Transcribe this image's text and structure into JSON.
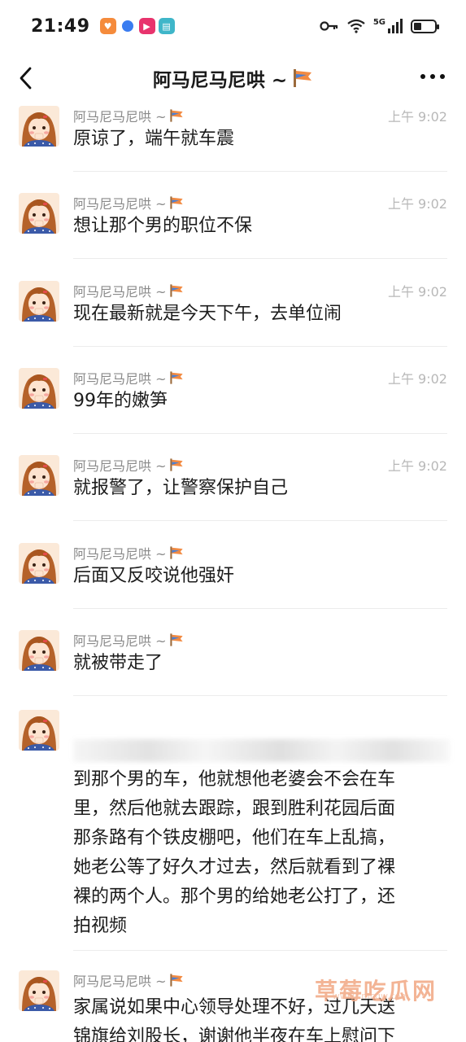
{
  "status_bar": {
    "time": "21:49",
    "network_label": "5G"
  },
  "nav": {
    "title": "阿马尼马尼哄 ~"
  },
  "messages": [
    {
      "sender": "阿马尼马尼哄 ~",
      "time": "上午 9:02",
      "text": "原谅了，端午就车震"
    },
    {
      "sender": "阿马尼马尼哄 ~",
      "time": "上午 9:02",
      "text": "想让那个男的职位不保"
    },
    {
      "sender": "阿马尼马尼哄 ~",
      "time": "上午 9:02",
      "text": "现在最新就是今天下午，去单位闹"
    },
    {
      "sender": "阿马尼马尼哄 ~",
      "time": "上午 9:02",
      "text": "99年的嫩笋"
    },
    {
      "sender": "阿马尼马尼哄 ~",
      "time": "上午 9:02",
      "text": "就报警了，让警察保护自己"
    },
    {
      "sender": "阿马尼马尼哄 ~",
      "time": "",
      "text": "后面又反咬说他强奸"
    },
    {
      "sender": "阿马尼马尼哄 ~",
      "time": "",
      "text": "就被带走了"
    }
  ],
  "long_message": {
    "lines": [
      "到那个男的车，他就想他老婆会不会在车",
      "里，然后他就去跟踪，跟到胜利花园后面",
      "那条路有个铁皮棚吧，他们在车上乱搞，",
      "她老公等了好久才过去，然后就看到了裸",
      "裸的两个人。那个男的给她老公打了，还",
      "拍视频"
    ]
  },
  "last_message": {
    "sender": "阿马尼马尼哄 ~",
    "lines": [
      "家属说如果中心领导处理不好，过几天送",
      "锦旗给刘股长，谢谢他半夜在车上慰问下"
    ]
  },
  "watermark": {
    "text": "草莓吃瓜网",
    "url": "www.cmcgw.com"
  }
}
